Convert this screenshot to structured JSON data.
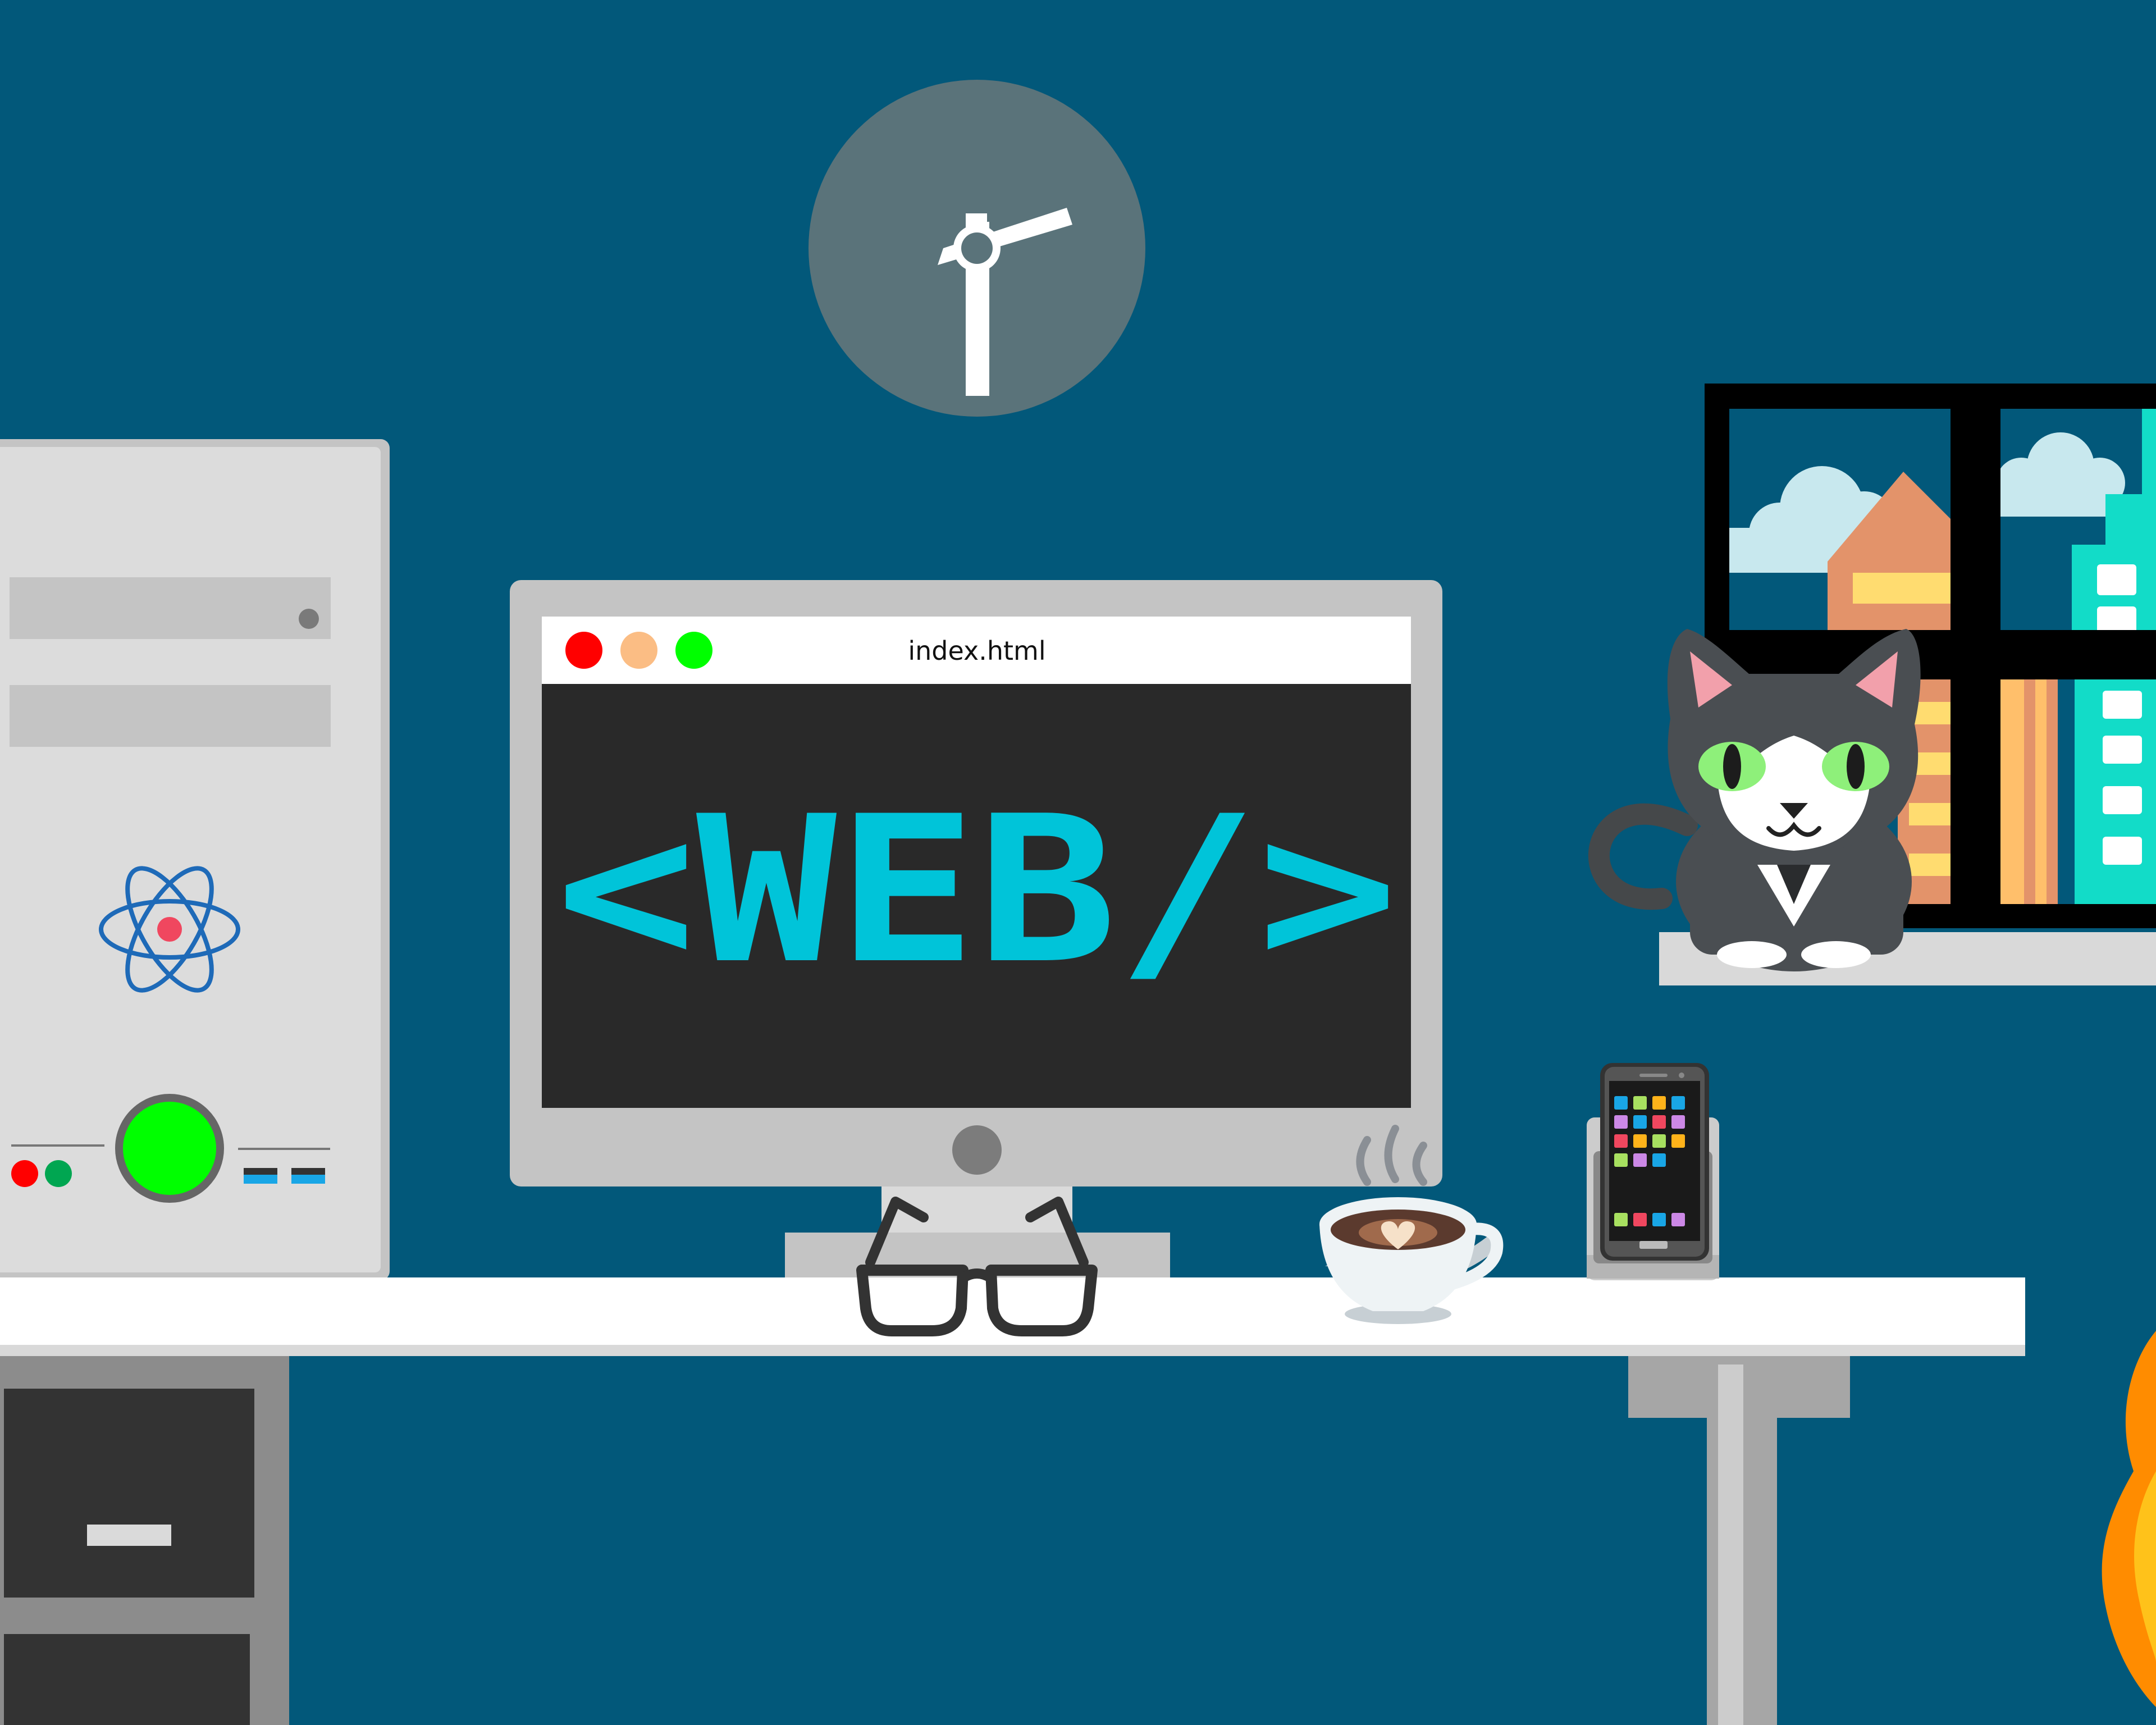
{
  "window": {
    "title": "index.html",
    "buttons": [
      "close",
      "minimize",
      "maximize"
    ]
  },
  "screen": {
    "text": "<WEB/>"
  },
  "colors": {
    "background": "#02587a",
    "screen_text": "#00c4d9",
    "screen_bg": "#292929",
    "power_button": "#00ff00",
    "close": "#ff0000",
    "minimize": "#fbbd84",
    "maximize": "#00ff00",
    "cat_eyes": "#8ef07a",
    "building_teal": "#12dcc8"
  },
  "icons": [
    "clock-icon",
    "atom-icon",
    "glasses-icon",
    "coffee-icon",
    "phone-icon",
    "cat-icon",
    "flame-icon"
  ]
}
